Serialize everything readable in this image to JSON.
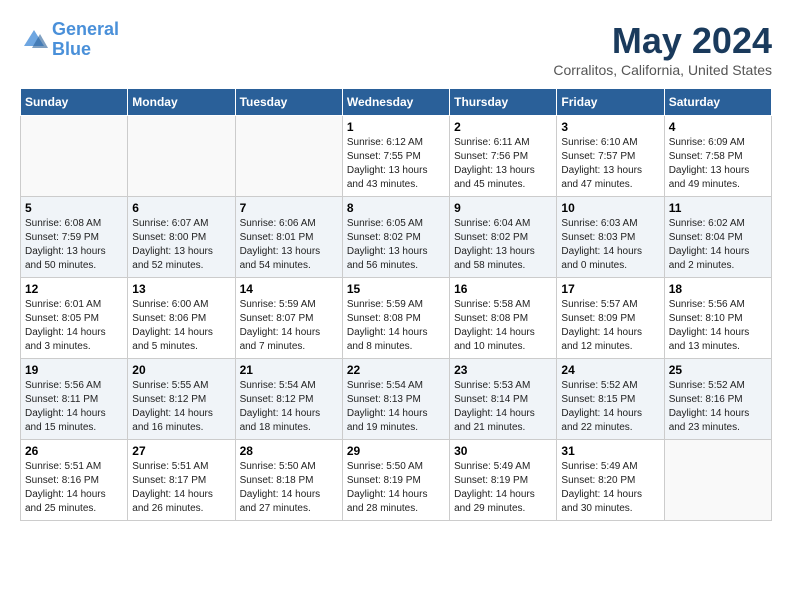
{
  "header": {
    "logo_line1": "General",
    "logo_line2": "Blue",
    "month": "May 2024",
    "location": "Corralitos, California, United States"
  },
  "weekdays": [
    "Sunday",
    "Monday",
    "Tuesday",
    "Wednesday",
    "Thursday",
    "Friday",
    "Saturday"
  ],
  "weeks": [
    [
      {
        "day": "",
        "info": ""
      },
      {
        "day": "",
        "info": ""
      },
      {
        "day": "",
        "info": ""
      },
      {
        "day": "1",
        "info": "Sunrise: 6:12 AM\nSunset: 7:55 PM\nDaylight: 13 hours\nand 43 minutes."
      },
      {
        "day": "2",
        "info": "Sunrise: 6:11 AM\nSunset: 7:56 PM\nDaylight: 13 hours\nand 45 minutes."
      },
      {
        "day": "3",
        "info": "Sunrise: 6:10 AM\nSunset: 7:57 PM\nDaylight: 13 hours\nand 47 minutes."
      },
      {
        "day": "4",
        "info": "Sunrise: 6:09 AM\nSunset: 7:58 PM\nDaylight: 13 hours\nand 49 minutes."
      }
    ],
    [
      {
        "day": "5",
        "info": "Sunrise: 6:08 AM\nSunset: 7:59 PM\nDaylight: 13 hours\nand 50 minutes."
      },
      {
        "day": "6",
        "info": "Sunrise: 6:07 AM\nSunset: 8:00 PM\nDaylight: 13 hours\nand 52 minutes."
      },
      {
        "day": "7",
        "info": "Sunrise: 6:06 AM\nSunset: 8:01 PM\nDaylight: 13 hours\nand 54 minutes."
      },
      {
        "day": "8",
        "info": "Sunrise: 6:05 AM\nSunset: 8:02 PM\nDaylight: 13 hours\nand 56 minutes."
      },
      {
        "day": "9",
        "info": "Sunrise: 6:04 AM\nSunset: 8:02 PM\nDaylight: 13 hours\nand 58 minutes."
      },
      {
        "day": "10",
        "info": "Sunrise: 6:03 AM\nSunset: 8:03 PM\nDaylight: 14 hours\nand 0 minutes."
      },
      {
        "day": "11",
        "info": "Sunrise: 6:02 AM\nSunset: 8:04 PM\nDaylight: 14 hours\nand 2 minutes."
      }
    ],
    [
      {
        "day": "12",
        "info": "Sunrise: 6:01 AM\nSunset: 8:05 PM\nDaylight: 14 hours\nand 3 minutes."
      },
      {
        "day": "13",
        "info": "Sunrise: 6:00 AM\nSunset: 8:06 PM\nDaylight: 14 hours\nand 5 minutes."
      },
      {
        "day": "14",
        "info": "Sunrise: 5:59 AM\nSunset: 8:07 PM\nDaylight: 14 hours\nand 7 minutes."
      },
      {
        "day": "15",
        "info": "Sunrise: 5:59 AM\nSunset: 8:08 PM\nDaylight: 14 hours\nand 8 minutes."
      },
      {
        "day": "16",
        "info": "Sunrise: 5:58 AM\nSunset: 8:08 PM\nDaylight: 14 hours\nand 10 minutes."
      },
      {
        "day": "17",
        "info": "Sunrise: 5:57 AM\nSunset: 8:09 PM\nDaylight: 14 hours\nand 12 minutes."
      },
      {
        "day": "18",
        "info": "Sunrise: 5:56 AM\nSunset: 8:10 PM\nDaylight: 14 hours\nand 13 minutes."
      }
    ],
    [
      {
        "day": "19",
        "info": "Sunrise: 5:56 AM\nSunset: 8:11 PM\nDaylight: 14 hours\nand 15 minutes."
      },
      {
        "day": "20",
        "info": "Sunrise: 5:55 AM\nSunset: 8:12 PM\nDaylight: 14 hours\nand 16 minutes."
      },
      {
        "day": "21",
        "info": "Sunrise: 5:54 AM\nSunset: 8:12 PM\nDaylight: 14 hours\nand 18 minutes."
      },
      {
        "day": "22",
        "info": "Sunrise: 5:54 AM\nSunset: 8:13 PM\nDaylight: 14 hours\nand 19 minutes."
      },
      {
        "day": "23",
        "info": "Sunrise: 5:53 AM\nSunset: 8:14 PM\nDaylight: 14 hours\nand 21 minutes."
      },
      {
        "day": "24",
        "info": "Sunrise: 5:52 AM\nSunset: 8:15 PM\nDaylight: 14 hours\nand 22 minutes."
      },
      {
        "day": "25",
        "info": "Sunrise: 5:52 AM\nSunset: 8:16 PM\nDaylight: 14 hours\nand 23 minutes."
      }
    ],
    [
      {
        "day": "26",
        "info": "Sunrise: 5:51 AM\nSunset: 8:16 PM\nDaylight: 14 hours\nand 25 minutes."
      },
      {
        "day": "27",
        "info": "Sunrise: 5:51 AM\nSunset: 8:17 PM\nDaylight: 14 hours\nand 26 minutes."
      },
      {
        "day": "28",
        "info": "Sunrise: 5:50 AM\nSunset: 8:18 PM\nDaylight: 14 hours\nand 27 minutes."
      },
      {
        "day": "29",
        "info": "Sunrise: 5:50 AM\nSunset: 8:19 PM\nDaylight: 14 hours\nand 28 minutes."
      },
      {
        "day": "30",
        "info": "Sunrise: 5:49 AM\nSunset: 8:19 PM\nDaylight: 14 hours\nand 29 minutes."
      },
      {
        "day": "31",
        "info": "Sunrise: 5:49 AM\nSunset: 8:20 PM\nDaylight: 14 hours\nand 30 minutes."
      },
      {
        "day": "",
        "info": ""
      }
    ]
  ]
}
